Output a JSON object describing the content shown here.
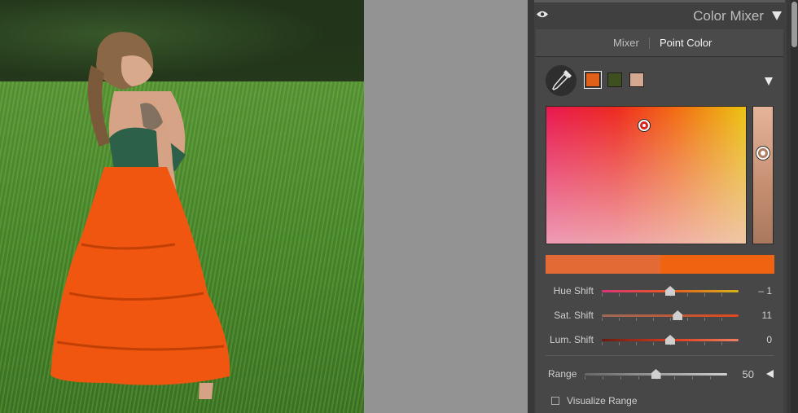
{
  "panel": {
    "title": "Color Mixer",
    "tabs": [
      {
        "label": "Mixer",
        "active": false
      },
      {
        "label": "Point Color",
        "active": true
      }
    ],
    "swatches": [
      "#e0601a",
      "#3e5020",
      "#d5a991"
    ],
    "selected_swatch": 0,
    "compare_colors": {
      "original": "#e46a35",
      "adjusted": "#ee6410"
    },
    "sliders": [
      {
        "label": "Hue Shift",
        "value": "– 1",
        "level": 0.5,
        "track": "linear-gradient(90deg,#d9347a,#e85b1f 50%,#d6b31a)"
      },
      {
        "label": "Sat. Shift",
        "value": "11",
        "level": 0.555,
        "track": "linear-gradient(90deg,#9b6b5a,#e0481c)"
      },
      {
        "label": "Lum. Shift",
        "value": "0",
        "level": 0.5,
        "track": "linear-gradient(90deg,#6a1a10,#e04020 55%,#f08060)"
      }
    ],
    "range": {
      "label": "Range",
      "value": "50",
      "level": 0.5
    },
    "visualize": {
      "label": "Visualize Range",
      "checked": false
    }
  },
  "icons": {
    "eye": "eye-icon",
    "collapse": "triangle-down-icon",
    "eyedropper": "eyedropper-icon",
    "range_toggle": "triangle-left-icon"
  }
}
